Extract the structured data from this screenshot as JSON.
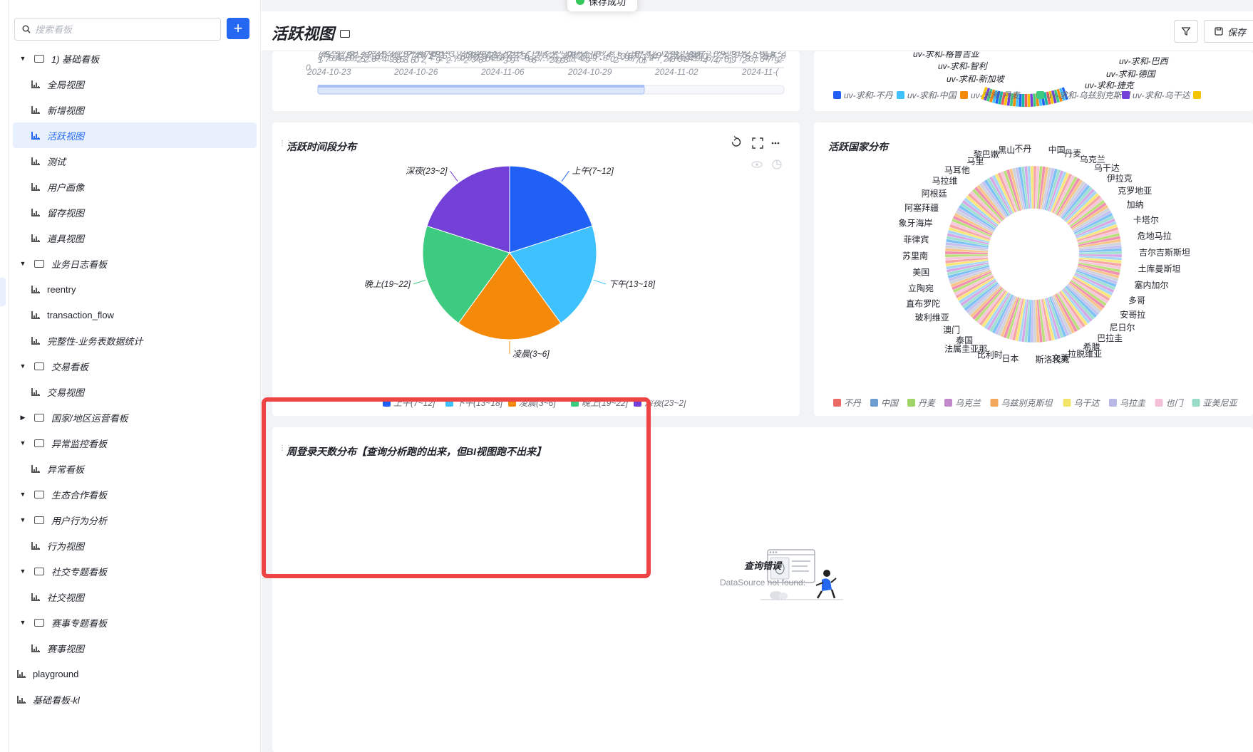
{
  "toast": {
    "text": "保存成功"
  },
  "sidebar": {
    "search_placeholder": "搜索看板",
    "add_label": "+",
    "tree": [
      {
        "kind": "folder",
        "level": 0,
        "expanded": true,
        "label": "1) 基础看板"
      },
      {
        "kind": "view",
        "level": 1,
        "label": "全局视图"
      },
      {
        "kind": "view",
        "level": 1,
        "label": "新增视图"
      },
      {
        "kind": "view",
        "level": 1,
        "label": "活跃视图",
        "active": true
      },
      {
        "kind": "view",
        "level": 1,
        "label": "测试"
      },
      {
        "kind": "view",
        "level": 1,
        "label": "用户画像"
      },
      {
        "kind": "view",
        "level": 1,
        "label": "留存视图"
      },
      {
        "kind": "view",
        "level": 1,
        "label": "道具视图"
      },
      {
        "kind": "folder",
        "level": 0,
        "expanded": true,
        "label": "业务日志看板"
      },
      {
        "kind": "view",
        "level": 1,
        "label": "reentry"
      },
      {
        "kind": "view",
        "level": 1,
        "label": "transaction_flow"
      },
      {
        "kind": "view",
        "level": 1,
        "label": "完整性-业务表数据统计"
      },
      {
        "kind": "folder",
        "level": 0,
        "expanded": true,
        "label": "交易看板"
      },
      {
        "kind": "view",
        "level": 1,
        "label": "交易视图"
      },
      {
        "kind": "folder",
        "level": 0,
        "expanded": false,
        "label": "国家/地区运营看板"
      },
      {
        "kind": "folder",
        "level": 0,
        "expanded": true,
        "label": "异常监控看板"
      },
      {
        "kind": "view",
        "level": 1,
        "label": "异常看板"
      },
      {
        "kind": "folder",
        "level": 0,
        "expanded": true,
        "label": "生态合作看板"
      },
      {
        "kind": "folder",
        "level": 0,
        "expanded": true,
        "label": "用户行为分析"
      },
      {
        "kind": "view",
        "level": 1,
        "label": "行为视图"
      },
      {
        "kind": "folder",
        "level": 0,
        "expanded": true,
        "label": "社交专题看板"
      },
      {
        "kind": "view",
        "level": 1,
        "label": "社交视图"
      },
      {
        "kind": "folder",
        "level": 0,
        "expanded": true,
        "label": "赛事专题看板"
      },
      {
        "kind": "view",
        "level": 1,
        "label": "赛事视图"
      },
      {
        "kind": "view",
        "level": 0,
        "label": "playground"
      },
      {
        "kind": "view",
        "level": 0,
        "label": "基础看板-kl"
      }
    ]
  },
  "header": {
    "title": "活跃视图",
    "save_label": "保存",
    "icons": [
      "comment-icon",
      "filter-icon",
      "save-icon"
    ]
  },
  "top_left_chart": {
    "zero_label": "0",
    "x_ticks": [
      "2024-10-23",
      "2024-10-26",
      "2024-11-06",
      "2024-10-29",
      "2024-11-02",
      "2024-11-("
    ]
  },
  "top_right_chart": {
    "labels": [
      "uv-求和-格鲁吉亚",
      "uv-求和-智利",
      "uv-求和-新加坡",
      "uv-求和-巴西",
      "uv-求和-德国",
      "uv-求和-捷克"
    ],
    "legend": [
      "uv-求和-不丹",
      "uv-求和-中国",
      "uv-求和-丹麦",
      "uv-求和-乌兹别克斯坦",
      "uv-求和-乌干达"
    ]
  },
  "pie_card": {
    "title": "活跃时间段分布",
    "icons": [
      "refresh-icon",
      "fullscreen-icon",
      "more-icon",
      "eye-icon",
      "pie-icon"
    ]
  },
  "country_card": {
    "title": "活跃国家分布",
    "labels": [
      "黑山",
      "不丹",
      "中国",
      "丹麦",
      "乌克兰",
      "乌干达",
      "伊拉克",
      "克罗地亚",
      "加纳",
      "卡塔尔",
      "危地马拉",
      "吉尔吉斯斯坦",
      "土库曼斯坦",
      "塞内加尔",
      "多哥",
      "安哥拉",
      "尼日尔",
      "巴拉圭",
      "希腊",
      "拉脱维亚",
      "文莱",
      "斯洛伐克",
      "日本",
      "比利时",
      "法属圭亚那",
      "泰国",
      "澳门",
      "玻利维亚",
      "直布罗陀",
      "立陶宛",
      "美国",
      "苏里南",
      "菲律宾",
      "象牙海岸",
      "阿塞拜疆",
      "阿根廷",
      "马拉维",
      "马耳他",
      "马里",
      "黎巴嫩"
    ],
    "legend": [
      "不丹",
      "中国",
      "丹麦",
      "乌克兰",
      "乌兹别克斯坦",
      "乌干达",
      "乌拉圭",
      "也门",
      "亚美尼亚"
    ]
  },
  "login_card": {
    "title": "周登录天数分布【查询分析跑的出来，但BI视图跑不出来】",
    "error_title": "查询错误",
    "error_message": "DataSource not found:"
  },
  "chart_data": [
    {
      "type": "pie",
      "title": "活跃时间段分布",
      "categories": [
        "上午(7~12]",
        "下午(13~18]",
        "凌晨(3~6]",
        "晚上(19~22]",
        "深夜(23~2]"
      ],
      "values": [
        20,
        20,
        20,
        20,
        20
      ],
      "colors": [
        "#2160f5",
        "#3ec1fc",
        "#f5890a",
        "#3ccb7f",
        "#7441d8"
      ],
      "legend_position": "bottom"
    },
    {
      "type": "pie",
      "title": "活跃国家分布",
      "donut": true,
      "categories": [
        "黑山",
        "不丹",
        "中国",
        "丹麦",
        "乌克兰",
        "乌干达",
        "伊拉克",
        "克罗地亚",
        "加纳",
        "卡塔尔",
        "危地马拉",
        "吉尔吉斯斯坦",
        "土库曼斯坦",
        "塞内加尔",
        "多哥",
        "安哥拉",
        "尼日尔",
        "巴拉圭",
        "希腊",
        "拉脱维亚",
        "文莱",
        "斯洛伐克",
        "日本",
        "比利时",
        "法属圭亚那",
        "泰国",
        "澳门",
        "玻利维亚",
        "直布罗陀",
        "立陶宛",
        "美国",
        "苏里南",
        "菲律宾",
        "象牙海岸",
        "阿塞拜疆",
        "阿根廷",
        "马拉维",
        "马耳他",
        "马里",
        "黎巴嫩"
      ],
      "legend_position": "bottom"
    }
  ],
  "colors": {
    "accent": "#2468f2",
    "highlight": "#ef4444",
    "active_bg": "#e8f0fe"
  }
}
